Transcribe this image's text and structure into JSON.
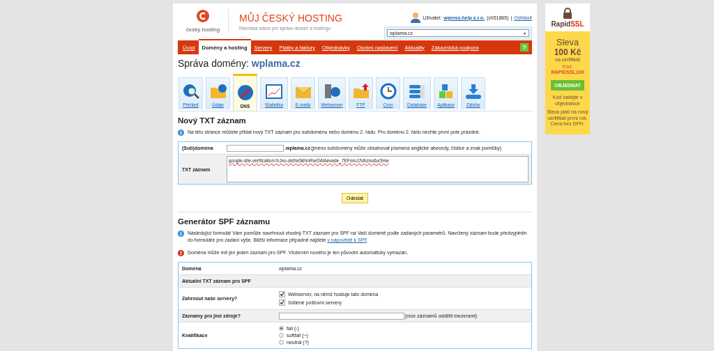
{
  "header": {
    "logo_text": "český hosting",
    "title": "MŮJ ČESKÝ HOSTING",
    "subtitle": "Klientská sekce pro správu domén a hostingu",
    "user_label": "Uživatel:",
    "user_name": "wpress.help s.r.o.",
    "user_id": "(ch51865)",
    "separator": "|",
    "logout": "Odhlásit",
    "domain_select": "wplama.cz",
    "select_arrow": "▼"
  },
  "nav": [
    {
      "label": "Úvod",
      "selected": false
    },
    {
      "label": "Domény a hosting",
      "selected": true
    },
    {
      "label": "Servery",
      "selected": false
    },
    {
      "label": "Platby a faktury",
      "selected": false
    },
    {
      "label": "Objednávky",
      "selected": false
    },
    {
      "label": "Osobní nastavení",
      "selected": false
    },
    {
      "label": "Aktuality",
      "selected": false
    },
    {
      "label": "Zákaznická podpora",
      "selected": false
    }
  ],
  "help": "?",
  "page_title": {
    "prefix": "Správa domény:",
    "domain": "wplama.cz"
  },
  "tabs": [
    {
      "label": "Přehled",
      "selected": false
    },
    {
      "label": "Údaje",
      "selected": false
    },
    {
      "label": "DNS",
      "selected": true
    },
    {
      "label": "Statistiky",
      "selected": false
    },
    {
      "label": "E-maily",
      "selected": false
    },
    {
      "label": "Webserver",
      "selected": false
    },
    {
      "label": "FTP",
      "selected": false
    },
    {
      "label": "Cron",
      "selected": false
    },
    {
      "label": "Databáze",
      "selected": false
    },
    {
      "label": "Aplikace",
      "selected": false
    },
    {
      "label": "Zálohy",
      "selected": false
    }
  ],
  "txt_section": {
    "heading": "Nový TXT záznam",
    "info": "Na této stránce můžete přidat nový TXT záznam pro subdoménu nebo doménu 2. řádu. Pro doménu 2. řádu nechte první pole prázdné.",
    "subdomain_label": "(Sub)doména",
    "subdomain_suffix": ".wplama.cz",
    "subdomain_hint": "(jméno subdomény může obsahovat písmena anglické abecedy, číslice a znak pomlčky)",
    "txt_label": "TXT záznam",
    "txt_value": "google-site-verification=hJxo-okthx0klhnRwGWAevade_7EFnmJJVAznu6uOHw",
    "submit": "Odeslat"
  },
  "spf_section": {
    "heading": "Generátor SPF záznamu",
    "info": "Následující formulář Vám pomůže navrhnout vhodný TXT záznam pro SPF na Vaší doméně podle zadaných parametrů. Navržený záznam bude předvyplněn do formuláře pro zadání výše. Bližší informace případně najdete",
    "info_link": "v nápovědě k SPF",
    "info_end": ".",
    "warning": "Doména může mít jen jeden záznam pro SPF. Vložením nového je ten původní automaticky vymazán.",
    "rows": [
      {
        "kind": "text",
        "label": "Doména",
        "value": "wplama.cz"
      },
      {
        "kind": "header",
        "label": "Aktuální TXT záznam pro SPF"
      },
      {
        "kind": "checkboxes",
        "label": "Zahrnout naše servery?",
        "options": [
          {
            "label": "Webserver, na němž hostuje tato doména",
            "checked": true
          },
          {
            "label": "Sdílené poštovní servery",
            "checked": true
          }
        ]
      },
      {
        "kind": "input",
        "label": "Záznamy pro jiné zdroje?",
        "hint": "(více záznamů oddělit mezerami)"
      },
      {
        "kind": "radios",
        "label": "Kvalifikace",
        "options": [
          {
            "label": "fail (-)",
            "selected": true
          },
          {
            "label": "softfail (~)",
            "selected": false
          },
          {
            "label": "neutral (?)",
            "selected": false
          }
        ]
      }
    ]
  },
  "ad": {
    "brand": "Rapid",
    "brand_accent": "SSL",
    "line1": "Sleva",
    "line2": "100 Kč",
    "line3": "na certifikát",
    "code_label": "Kód:",
    "code": "RAPIDSSL100",
    "button": "OBJEDNAT",
    "note1": "Kód zadejte v objednávce",
    "note2": "Sleva platí na nový certifikát první rok. Cena bez DPH."
  }
}
